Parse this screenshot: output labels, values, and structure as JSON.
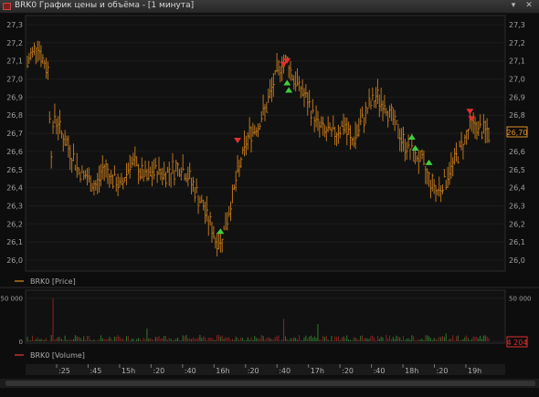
{
  "window": {
    "title": "BRK0 График цены и объёма - [1 минута]",
    "menu_icon": "chevron-down-icon",
    "close_icon": "close-icon"
  },
  "price_panel": {
    "legend_label": "BRK0 [Price]",
    "y_ticks": [
      "27,3",
      "27,2",
      "27,1",
      "27,0",
      "26,9",
      "26,8",
      "26,7",
      "26,6",
      "26,5",
      "26,4",
      "26,3",
      "26,2",
      "26,1",
      "26,0"
    ],
    "last_value": "26,70",
    "colors": {
      "bar": "#b8741d",
      "buy_arrow": "#3fcf3f",
      "sell_arrow": "#e03030",
      "last_value": "#e0902a"
    }
  },
  "volume_panel": {
    "legend_label": "BRK0 [Volume]",
    "y_ticks": [
      "50 000",
      "0"
    ],
    "last_value": "4 204",
    "colors": {
      "up": "#2f7a2f",
      "down": "#8a2424",
      "last_value": "#e03030"
    }
  },
  "x_axis": {
    "ticks": [
      ":25",
      ":45",
      "15h",
      ":20",
      ":40",
      "16h",
      ":20",
      ":40",
      "17h",
      ":20",
      ":40",
      "18h",
      ":20",
      "19h"
    ]
  },
  "chart_data": {
    "type": "bar",
    "price_ylim": [
      26.0,
      27.3
    ],
    "volume_ylim": [
      0,
      55000
    ],
    "price_points": [
      [
        0,
        27.08
      ],
      [
        3,
        27.15
      ],
      [
        6,
        27.2
      ],
      [
        9,
        27.1
      ],
      [
        12,
        27.05
      ],
      [
        14,
        26.6
      ],
      [
        16,
        26.8
      ],
      [
        20,
        26.7
      ],
      [
        25,
        26.6
      ],
      [
        30,
        26.5
      ],
      [
        35,
        26.45
      ],
      [
        40,
        26.4
      ],
      [
        45,
        26.52
      ],
      [
        50,
        26.45
      ],
      [
        55,
        26.4
      ],
      [
        60,
        26.55
      ],
      [
        65,
        26.5
      ],
      [
        70,
        26.45
      ],
      [
        75,
        26.5
      ],
      [
        80,
        26.48
      ],
      [
        85,
        26.5
      ],
      [
        90,
        26.52
      ],
      [
        95,
        26.45
      ],
      [
        100,
        26.35
      ],
      [
        105,
        26.25
      ],
      [
        110,
        26.12
      ],
      [
        113,
        26.1
      ],
      [
        116,
        26.2
      ],
      [
        120,
        26.35
      ],
      [
        125,
        26.55
      ],
      [
        130,
        26.7
      ],
      [
        135,
        26.75
      ],
      [
        140,
        26.85
      ],
      [
        145,
        27.0
      ],
      [
        148,
        27.08
      ],
      [
        152,
        27.1
      ],
      [
        156,
        27.0
      ],
      [
        160,
        26.95
      ],
      [
        165,
        26.85
      ],
      [
        170,
        26.75
      ],
      [
        175,
        26.7
      ],
      [
        180,
        26.7
      ],
      [
        185,
        26.75
      ],
      [
        190,
        26.65
      ],
      [
        195,
        26.75
      ],
      [
        200,
        26.85
      ],
      [
        205,
        26.9
      ],
      [
        210,
        26.85
      ],
      [
        215,
        26.75
      ],
      [
        220,
        26.65
      ],
      [
        225,
        26.6
      ],
      [
        230,
        26.55
      ],
      [
        235,
        26.45
      ],
      [
        240,
        26.38
      ],
      [
        245,
        26.45
      ],
      [
        250,
        26.55
      ],
      [
        255,
        26.65
      ],
      [
        260,
        26.75
      ],
      [
        265,
        26.72
      ],
      [
        270,
        26.7
      ]
    ],
    "buy_signals": [
      [
        113,
        26.16
      ],
      [
        152,
        26.98
      ],
      [
        153,
        26.94
      ],
      [
        225,
        26.68
      ],
      [
        227,
        26.62
      ],
      [
        235,
        26.54
      ]
    ],
    "sell_signals": [
      [
        123,
        26.66
      ],
      [
        150,
        27.08
      ],
      [
        152,
        27.1
      ],
      [
        259,
        26.82
      ],
      [
        260,
        26.78
      ]
    ],
    "volume_spikes": [
      [
        15,
        50000
      ],
      [
        70,
        15000
      ],
      [
        150,
        26000
      ],
      [
        170,
        20000
      ],
      [
        245,
        9000
      ]
    ]
  }
}
